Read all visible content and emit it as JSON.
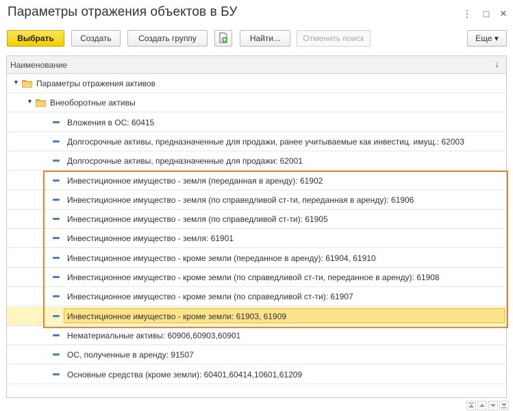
{
  "window": {
    "title": "Параметры отражения объектов в БУ",
    "menu_glyph": "⋮",
    "maximize_glyph": "□",
    "close_glyph": "×"
  },
  "toolbar": {
    "select_label": "Выбрать",
    "create_label": "Создать",
    "create_group_label": "Создать группу",
    "find_label": "Найти...",
    "cancel_search_label": "Отменить поиск",
    "more_label": "Еще ▾"
  },
  "grid": {
    "column_header": "Наименование",
    "sort_glyph": "↓",
    "rows": [
      {
        "level": 0,
        "type": "group",
        "label": "Параметры отражения активов"
      },
      {
        "level": 1,
        "type": "group",
        "label": "Внеоборотные активы"
      },
      {
        "level": 2,
        "type": "item",
        "label": "Вложения в ОС: 60415"
      },
      {
        "level": 2,
        "type": "item",
        "label": "Долгосрочные активы, предназначенные для продажи, ранее учитываемые как инвестиц. имущ.: 62003"
      },
      {
        "level": 2,
        "type": "item",
        "label": "Долгосрочные активы, предназначенные для продажи: 62001"
      },
      {
        "level": 2,
        "type": "item",
        "label": "Инвестиционное имущество - земля (переданная в аренду): 61902"
      },
      {
        "level": 2,
        "type": "item",
        "label": "Инвестиционное имущество - земля (по справедливой ст-ти, переданная в аренду): 61906"
      },
      {
        "level": 2,
        "type": "item",
        "label": "Инвестиционное имущество - земля (по справедливой ст-ти): 61905"
      },
      {
        "level": 2,
        "type": "item",
        "label": "Инвестиционное имущество - земля: 61901"
      },
      {
        "level": 2,
        "type": "item",
        "label": "Инвестиционное имущество - кроме земли (переданное в аренду): 61904, 61910"
      },
      {
        "level": 2,
        "type": "item",
        "label": "Инвестиционное имущество - кроме земли (по справедливой ст-ти, переданное в аренду): 61908"
      },
      {
        "level": 2,
        "type": "item",
        "label": "Инвестиционное имущество - кроме земли (по справедливой ст-ти): 61907"
      },
      {
        "level": 2,
        "type": "item",
        "label": "Инвестиционное имущество - кроме земли: 61903, 61909",
        "selected": true
      },
      {
        "level": 2,
        "type": "item",
        "label": "Нематериальные активы: 60906,60903,60901"
      },
      {
        "level": 2,
        "type": "item",
        "label": "ОС, полученные в аренду: 91507"
      },
      {
        "level": 2,
        "type": "item",
        "label": "Основные средства (кроме земли): 60401,60414,10601,61209"
      }
    ]
  },
  "colors": {
    "primary_button": "#f4cc00",
    "highlight_frame": "#f0802a",
    "selected_row": "#fbe38b",
    "folder": "#e8b84a",
    "item_marker": "#4a7fc0"
  }
}
